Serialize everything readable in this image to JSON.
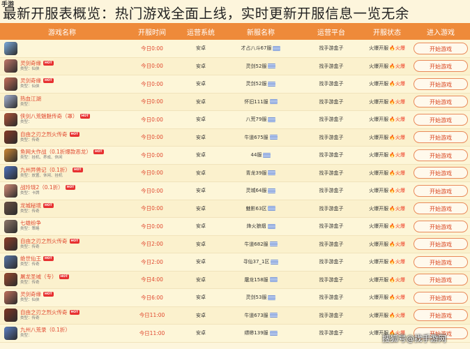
{
  "headline": "最新开服表概览：热门游戏全面上线，实时更新开服信息一览无余",
  "site_logo": "手游",
  "watermark": "搜狐号@找手游网",
  "colors": {
    "header_bg": "#ee8a3a",
    "title_text": "#e0472e",
    "row_bg": "#fdf6d8",
    "button_border": "#e98a5a"
  },
  "columns": [
    "游戏名称",
    "开服时间",
    "运营系统",
    "新服名称",
    "运营平台",
    "开服状态",
    "进入游戏"
  ],
  "rows": [
    {
      "title": "",
      "type": "",
      "hot": false,
      "time": "今日0:00",
      "system": "安卓",
      "server": "才占八斗67服",
      "platform": "找手游盒子",
      "status_label": "火爆开服",
      "status_hot": "火爆",
      "button": "开始游戏",
      "icon": "#7eaee0"
    },
    {
      "title": "灵剑奇缘",
      "type": "类型：仙侠",
      "hot": true,
      "time": "今日0:00",
      "system": "安卓",
      "server": "灵剑52服",
      "platform": "找手游盒子",
      "status_label": "火爆开服",
      "status_hot": "火爆",
      "button": "开始游戏",
      "icon": "#c3786a"
    },
    {
      "title": "灵剑奇缘",
      "type": "类型：仙侠",
      "hot": true,
      "time": "今日0:00",
      "system": "安卓",
      "server": "灵剑52服",
      "platform": "找手游盒子",
      "status_label": "火爆开服",
      "status_hot": "火爆",
      "button": "开始游戏",
      "icon": "#c96f5a"
    },
    {
      "title": "热血江湖",
      "type": "类型：",
      "hot": false,
      "time": "今日0:00",
      "system": "安卓",
      "server": "怀旧111服",
      "platform": "找手游盒子",
      "status_label": "火爆开服",
      "status_hot": "火爆",
      "button": "开始游戏",
      "icon": "#a9b6d6"
    },
    {
      "title": "侠剑八荒魅魅传奇（罩）",
      "type": "类型：",
      "hot": true,
      "time": "今日0:00",
      "system": "安卓",
      "server": "八荒79服",
      "platform": "找手游盒子",
      "status_label": "火爆开服",
      "status_hot": "火爆",
      "button": "开始游戏",
      "icon": "#b2553a"
    },
    {
      "title": "自由之刃之烈火传奇",
      "type": "类型：传奇",
      "hot": true,
      "time": "今日0:00",
      "system": "安卓",
      "server": "牛道675服",
      "platform": "找手游盒子",
      "status_label": "火爆开服",
      "status_hot": "火爆",
      "button": "开始游戏",
      "icon": "#8a3b27"
    },
    {
      "title": "鱼网大作战（0.1折爆款恶龙）",
      "type": "类型：挂机、养成、休闲",
      "hot": true,
      "time": "今日0:00",
      "system": "安卓",
      "server": "44服",
      "platform": "找手游盒子",
      "status_label": "火爆开服",
      "status_hot": "火爆",
      "button": "开始游戏",
      "icon": "#d08a34"
    },
    {
      "title": "九州异兽记（0.1折）",
      "type": "类型：放置、休闲、挂机",
      "hot": true,
      "time": "今日0:00",
      "system": "安卓",
      "server": "青龙39服",
      "platform": "找手游盒子",
      "status_label": "火爆开服",
      "status_hot": "火爆",
      "button": "开始游戏",
      "icon": "#4f73bf"
    },
    {
      "title": "战玲珑2（0.1折）",
      "type": "类型：卡牌",
      "hot": true,
      "time": "今日0:00",
      "system": "安卓",
      "server": "灵城64服",
      "platform": "找手游盒子",
      "status_label": "火爆开服",
      "status_hot": "火爆",
      "button": "开始游戏",
      "icon": "#d88f79"
    },
    {
      "title": "龙城秘境",
      "type": "类型：传奇",
      "hot": true,
      "time": "今日0:00",
      "system": "安卓",
      "server": "魅影63区",
      "platform": "找手游盒子",
      "status_label": "火爆开服",
      "status_hot": "火爆",
      "button": "开始游戏",
      "icon": "#6b5145"
    },
    {
      "title": "七雄纷争",
      "type": "类型：策略",
      "hot": false,
      "time": "今日0:00",
      "system": "安卓",
      "server": "烽火狼烟",
      "platform": "找手游盒子",
      "status_label": "火爆开服",
      "status_hot": "火爆",
      "button": "开始游戏",
      "icon": "#90786a"
    },
    {
      "title": "自由之刃之烈火传奇",
      "type": "类型：传奇",
      "hot": true,
      "time": "今日2:00",
      "system": "安卓",
      "server": "牛道682服",
      "platform": "找手游盒子",
      "status_label": "火爆开服",
      "status_hot": "火爆",
      "button": "开始游戏",
      "icon": "#8f3d28"
    },
    {
      "title": "绝世仙王",
      "type": "类型：传奇",
      "hot": true,
      "time": "今日2:00",
      "system": "安卓",
      "server": "寻仙37_1区",
      "platform": "找手游盒子",
      "status_label": "火爆开服",
      "status_hot": "火爆",
      "button": "开始游戏",
      "icon": "#5a78a8"
    },
    {
      "title": "屠龙圣域（专）",
      "type": "类型：传奇",
      "hot": true,
      "time": "今日4:00",
      "system": "安卓",
      "server": "屠龙158服",
      "platform": "找手游盒子",
      "status_label": "火爆开服",
      "status_hot": "火爆",
      "button": "开始游戏",
      "icon": "#9b4a2e"
    },
    {
      "title": "灵剑奇缘",
      "type": "类型：仙侠",
      "hot": true,
      "time": "今日6:00",
      "system": "安卓",
      "server": "灵剑53服",
      "platform": "找手游盒子",
      "status_label": "火爆开服",
      "status_hot": "火爆",
      "button": "开始游戏",
      "icon": "#c4725d"
    },
    {
      "title": "自由之刃之烈火传奇",
      "type": "类型：传奇",
      "hot": true,
      "time": "今日11:00",
      "system": "安卓",
      "server": "牛道673服",
      "platform": "找手游盒子",
      "status_label": "火爆开服",
      "status_hot": "火爆",
      "button": "开始游戏",
      "icon": "#7f3523"
    },
    {
      "title": "九州八荒录（0.1折）",
      "type": "类型：",
      "hot": false,
      "time": "今日11:00",
      "system": "安卓",
      "server": "缥缈139服",
      "platform": "找手游盒子",
      "status_label": "火爆开服",
      "status_hot": "火爆",
      "button": "开始游戏",
      "icon": "#5d82c6"
    }
  ]
}
